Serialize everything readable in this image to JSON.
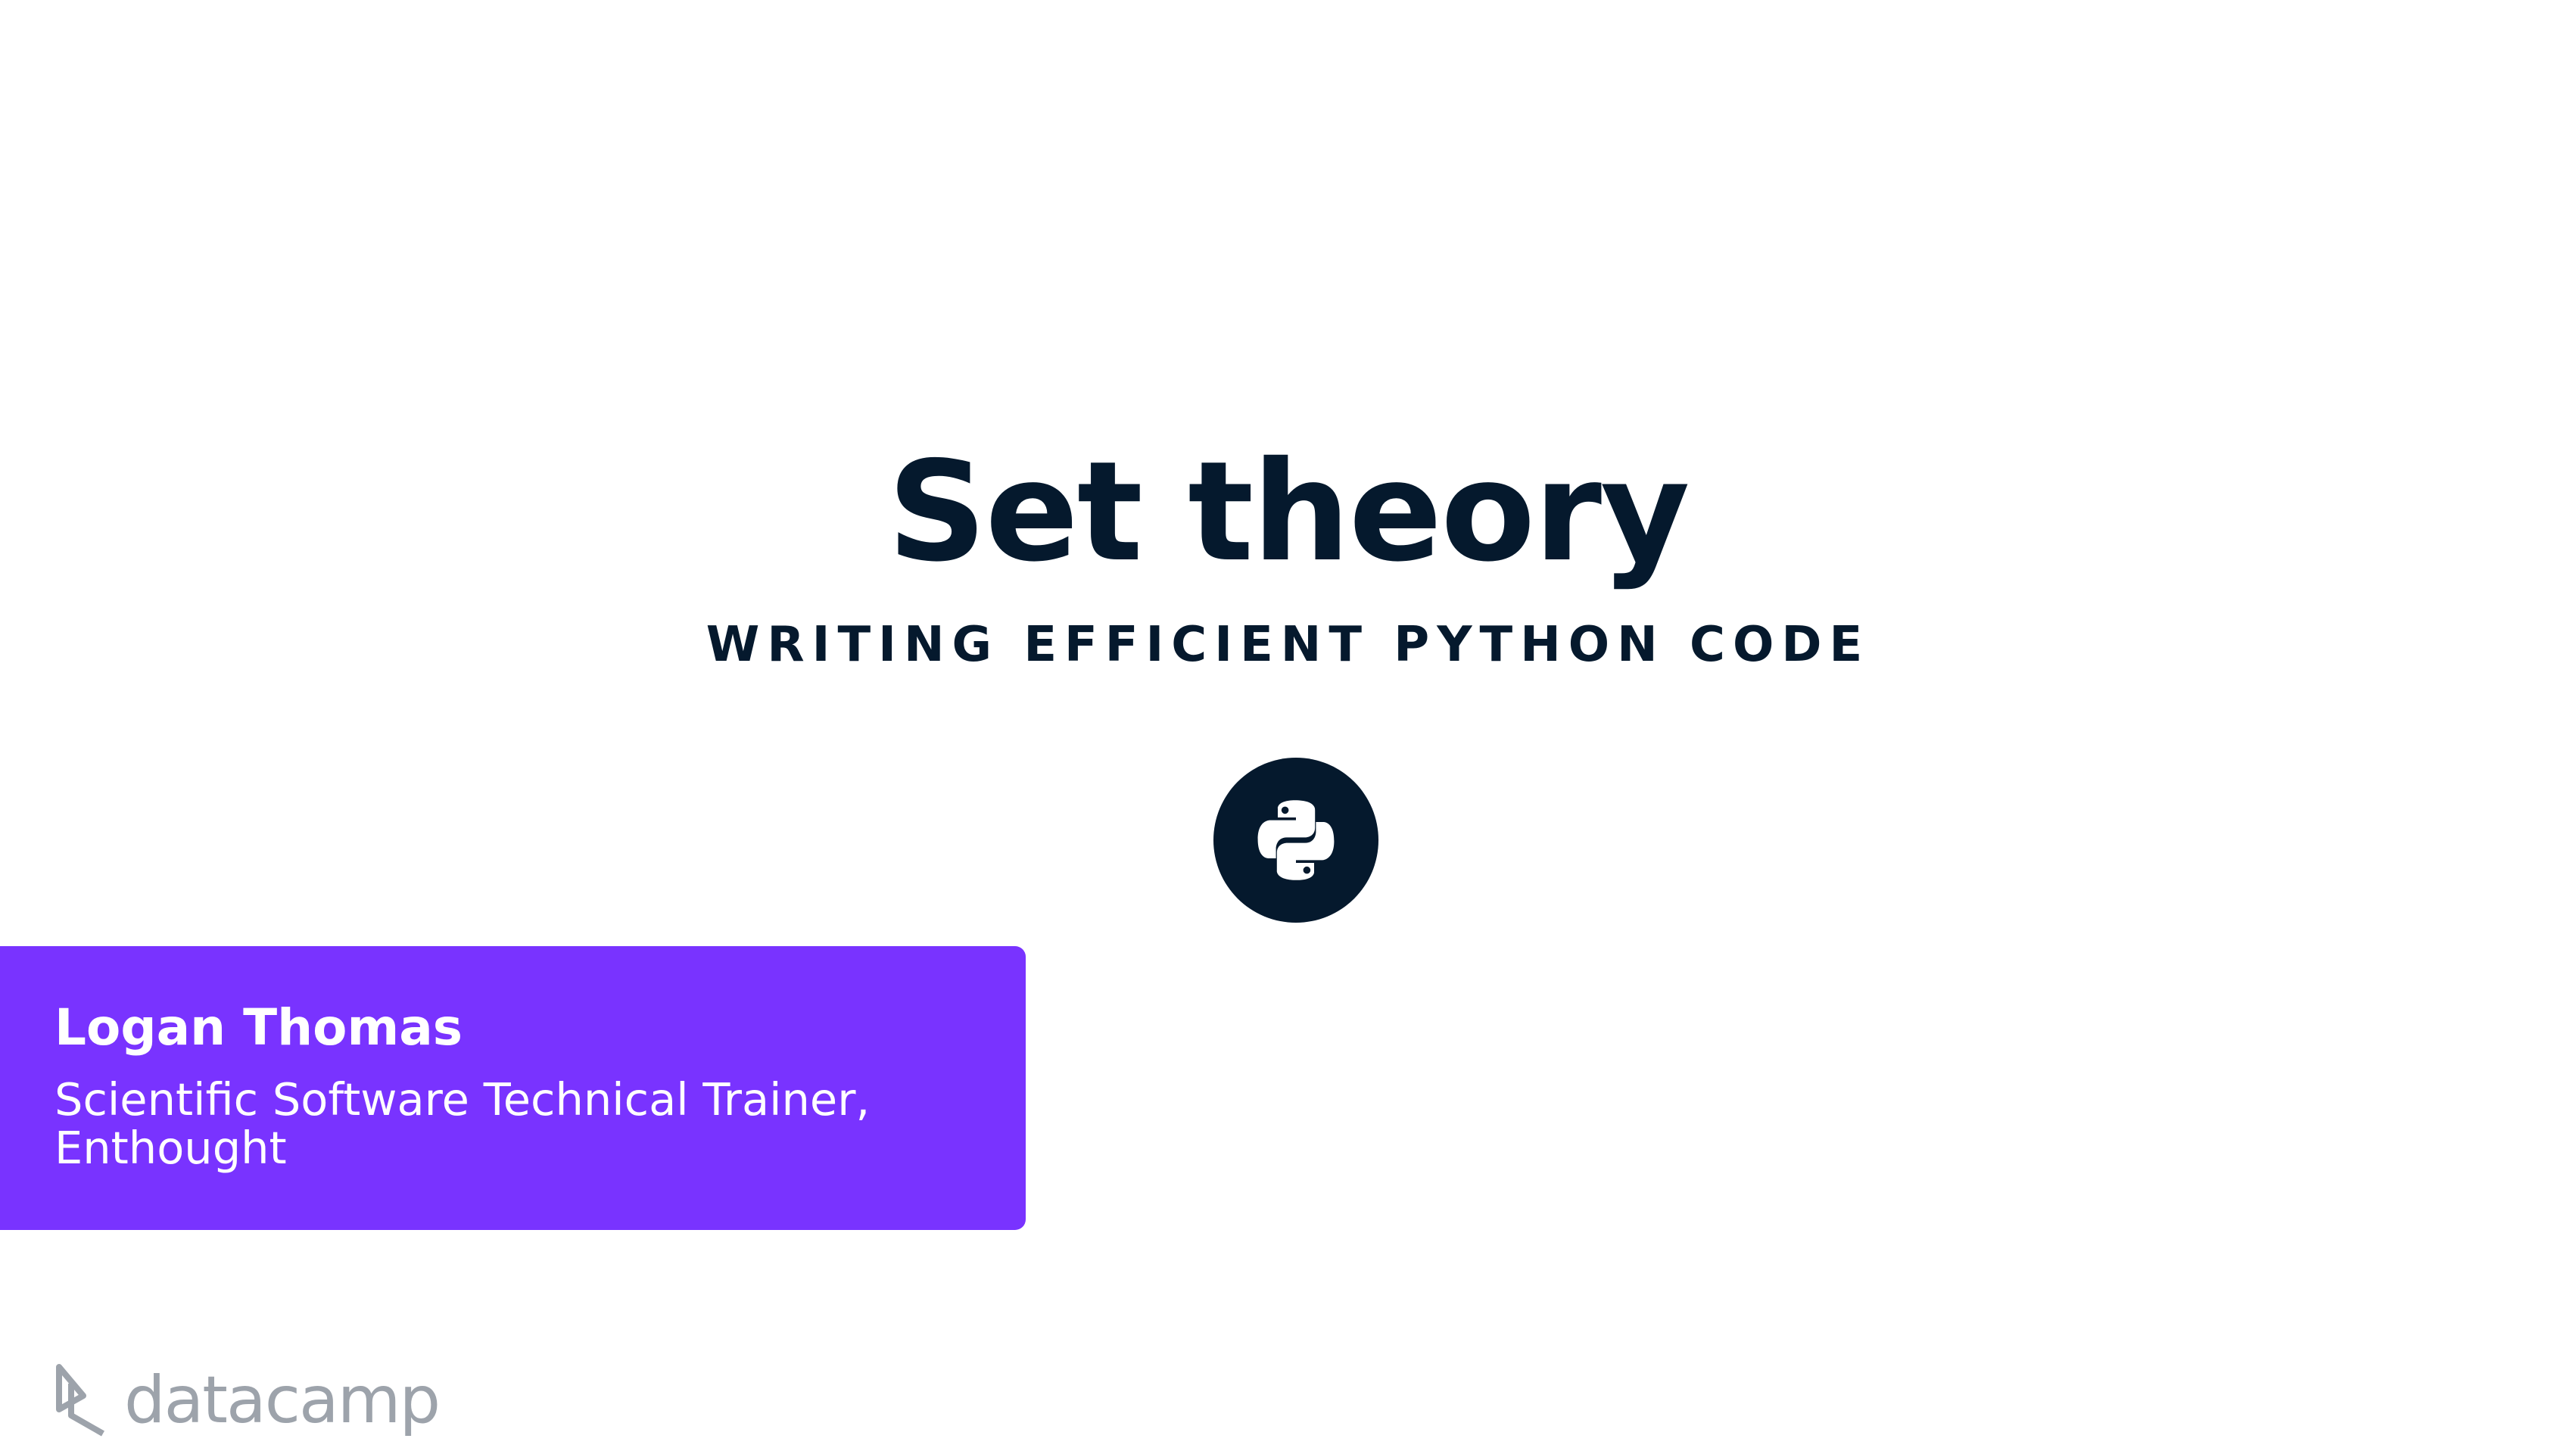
{
  "slide": {
    "title": "Set theory",
    "course": "WRITING EFFICIENT PYTHON CODE",
    "badge_icon": "python-logo-icon"
  },
  "presenter": {
    "name": "Logan Thomas",
    "role": "Scientific Software Technical Trainer, Enthought"
  },
  "brand": {
    "logo_text": "datacamp",
    "logo_icon": "datacamp-logo-icon"
  },
  "colors": {
    "navy": "#05192d",
    "purple": "#7933ff",
    "logo_gray": "#9da3ab",
    "background": "#ffffff"
  }
}
